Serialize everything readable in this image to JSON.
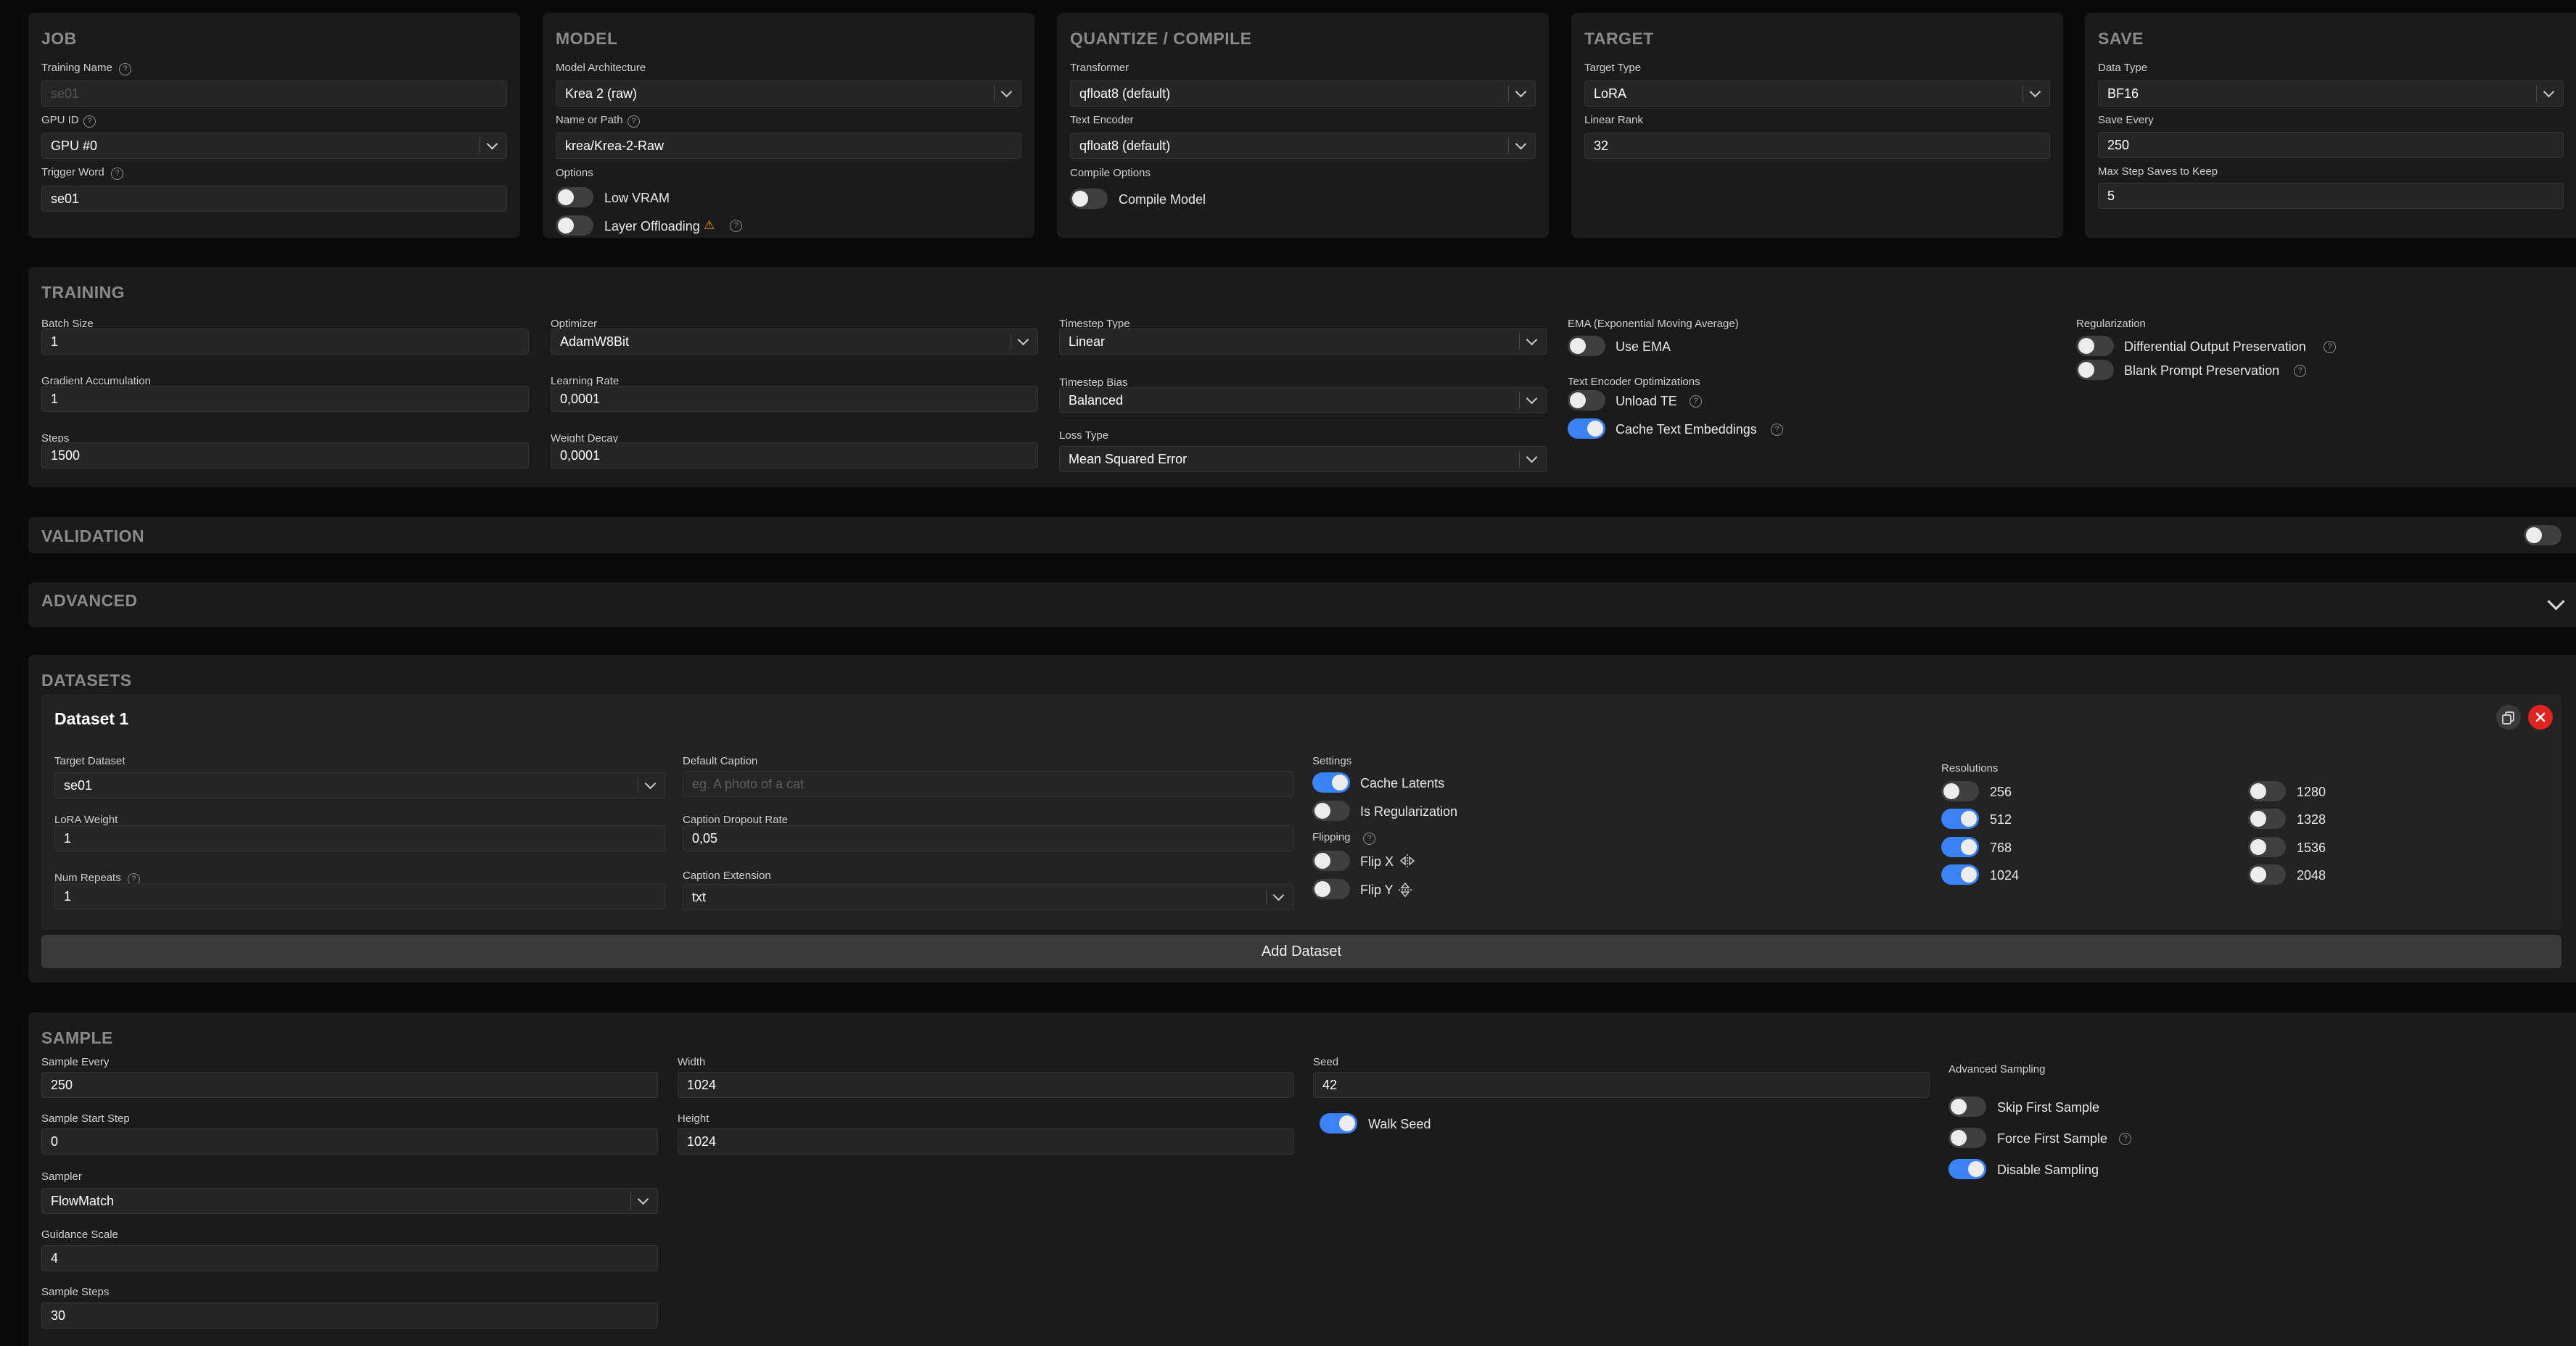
{
  "job": {
    "title": "JOB",
    "training_name_label": "Training Name",
    "training_name_value": "se01",
    "gpu_id_label": "GPU ID",
    "gpu_id_value": "GPU #0",
    "trigger_word_label": "Trigger Word",
    "trigger_word_value": "se01"
  },
  "model": {
    "title": "MODEL",
    "arch_label": "Model Architecture",
    "arch_value": "Krea 2 (raw)",
    "path_label": "Name or Path",
    "path_value": "krea/Krea-2-Raw",
    "options_label": "Options",
    "low_vram_label": "Low VRAM",
    "layer_offloading_label": "Layer Offloading",
    "warning_glyph": "⚠"
  },
  "quantize": {
    "title": "QUANTIZE / COMPILE",
    "transformer_label": "Transformer",
    "transformer_value": "qfloat8 (default)",
    "text_encoder_label": "Text Encoder",
    "text_encoder_value": "qfloat8 (default)",
    "compile_options_label": "Compile Options",
    "compile_model_label": "Compile Model"
  },
  "target": {
    "title": "TARGET",
    "type_label": "Target Type",
    "type_value": "LoRA",
    "rank_label": "Linear Rank",
    "rank_value": "32"
  },
  "save": {
    "title": "SAVE",
    "dtype_label": "Data Type",
    "dtype_value": "BF16",
    "every_label": "Save Every",
    "every_value": "250",
    "max_label": "Max Step Saves to Keep",
    "max_value": "5"
  },
  "training": {
    "title": "TRAINING",
    "batch_label": "Batch Size",
    "batch_value": "1",
    "grad_label": "Gradient Accumulation",
    "grad_value": "1",
    "steps_label": "Steps",
    "steps_value": "1500",
    "optimizer_label": "Optimizer",
    "optimizer_value": "AdamW8Bit",
    "lr_label": "Learning Rate",
    "lr_value": "0,0001",
    "wd_label": "Weight Decay",
    "wd_value": "0,0001",
    "ts_type_label": "Timestep Type",
    "ts_type_value": "Linear",
    "ts_bias_label": "Timestep Bias",
    "ts_bias_value": "Balanced",
    "loss_label": "Loss Type",
    "loss_value": "Mean Squared Error",
    "ema_label": "EMA (Exponential Moving Average)",
    "use_ema_label": "Use EMA",
    "te_opt_label": "Text Encoder Optimizations",
    "unload_te_label": "Unload TE",
    "cache_te_label": "Cache Text Embeddings",
    "reg_label": "Regularization",
    "dop_label": "Differential Output Preservation",
    "bpp_label": "Blank Prompt Preservation"
  },
  "validation": {
    "title": "VALIDATION"
  },
  "advanced": {
    "title": "ADVANCED"
  },
  "datasets": {
    "title": "DATASETS",
    "dataset_title": "Dataset 1",
    "target_label": "Target Dataset",
    "target_value": "se01",
    "lora_weight_label": "LoRA Weight",
    "lora_weight_value": "1",
    "repeats_label": "Num Repeats",
    "repeats_value": "1",
    "caption_label": "Default Caption",
    "caption_placeholder": "eg. A photo of a cat",
    "dropout_label": "Caption Dropout Rate",
    "dropout_value": "0,05",
    "ext_label": "Caption Extension",
    "ext_value": "txt",
    "settings_label": "Settings",
    "cache_latents_label": "Cache Latents",
    "is_reg_label": "Is Regularization",
    "flipping_label": "Flipping",
    "flip_x_label": "Flip X",
    "flip_y_label": "Flip Y",
    "resolutions_label": "Resolutions",
    "res": [
      "256",
      "512",
      "768",
      "1024",
      "1280",
      "1328",
      "1536",
      "2048"
    ],
    "add_label": "Add Dataset"
  },
  "sample": {
    "title": "SAMPLE",
    "every_label": "Sample Every",
    "every_value": "250",
    "start_label": "Sample Start Step",
    "start_value": "0",
    "sampler_label": "Sampler",
    "sampler_value": "FlowMatch",
    "guidance_label": "Guidance Scale",
    "guidance_value": "4",
    "steps_label": "Sample Steps",
    "steps_value": "30",
    "width_label": "Width",
    "width_value": "1024",
    "height_label": "Height",
    "height_value": "1024",
    "seed_label": "Seed",
    "seed_value": "42",
    "walk_seed_label": "Walk Seed",
    "adv_label": "Advanced Sampling",
    "skip_label": "Skip First Sample",
    "force_label": "Force First Sample",
    "disable_label": "Disable Sampling"
  },
  "colors": {
    "accent": "#3b82f6",
    "danger": "#e02424",
    "panel": "#1b1b1b",
    "page": "#0a0a0a"
  }
}
